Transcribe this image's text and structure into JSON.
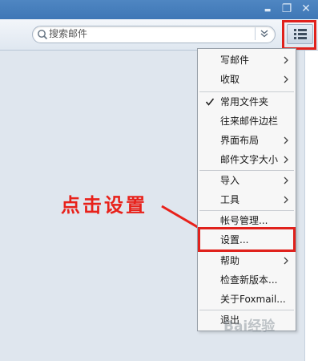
{
  "window": {
    "minimize": "▬",
    "restore": "❐",
    "close": "✕"
  },
  "search": {
    "placeholder": "搜索邮件"
  },
  "menu": {
    "items": [
      {
        "label": "写邮件",
        "submenu": true
      },
      {
        "label": "收取",
        "submenu": true
      },
      {
        "label": "常用文件夹",
        "checked": true
      },
      {
        "label": "往来邮件边栏"
      },
      {
        "label": "界面布局",
        "submenu": true
      },
      {
        "label": "邮件文字大小",
        "submenu": true
      },
      {
        "label": "导入",
        "submenu": true
      },
      {
        "label": "工具",
        "submenu": true
      },
      {
        "label": "帐号管理..."
      },
      {
        "label": "设置..."
      },
      {
        "label": "帮助",
        "submenu": true
      },
      {
        "label": "检查新版本..."
      },
      {
        "label": "关于Foxmail..."
      },
      {
        "label": "退出"
      }
    ]
  },
  "annotation": {
    "text": "点击设置"
  },
  "watermark": {
    "text": "Bai经验"
  },
  "colors": {
    "highlight": "#e0211c",
    "titlebar": "#4a81bf"
  }
}
